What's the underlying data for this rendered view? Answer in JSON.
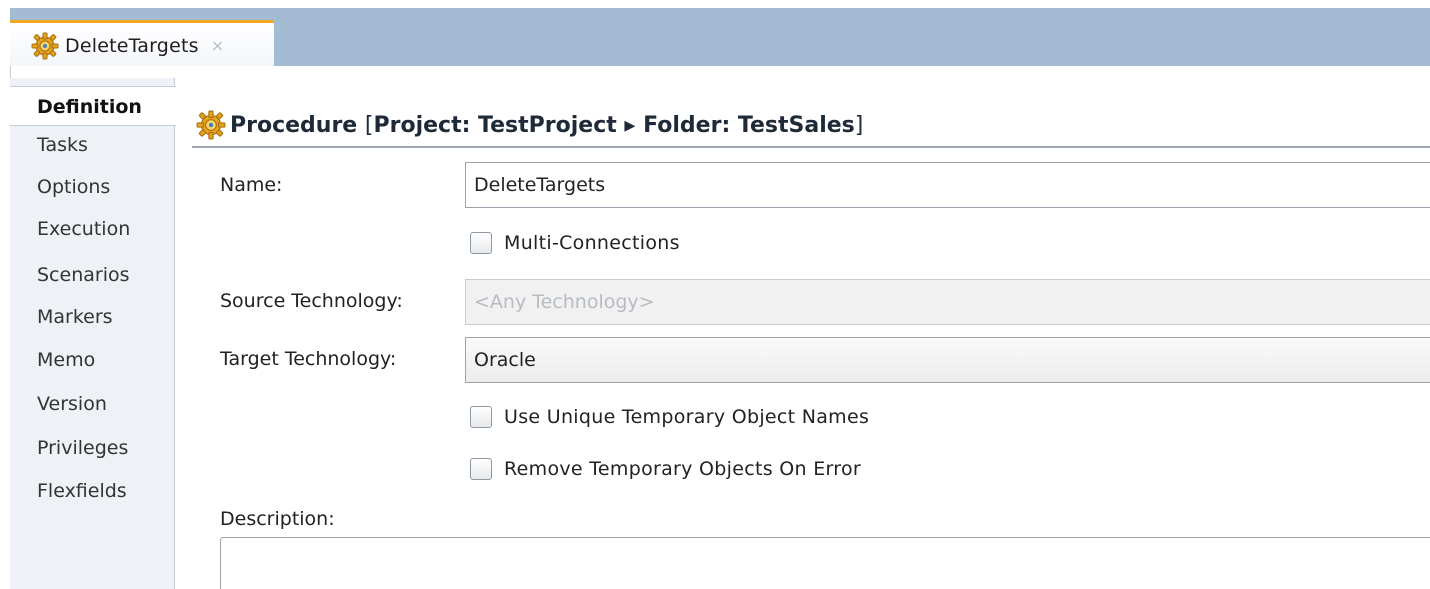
{
  "editor_tab": {
    "label": "DeleteTargets",
    "close_glyph": "×",
    "icon": "procedure-gear-icon"
  },
  "sidebar": {
    "items": [
      {
        "label": "Definition",
        "active": true
      },
      {
        "label": "Tasks",
        "active": false
      },
      {
        "label": "Options",
        "active": false
      },
      {
        "label": "Execution",
        "active": false
      },
      {
        "label": "Scenarios",
        "active": false
      },
      {
        "label": "Markers",
        "active": false
      },
      {
        "label": "Memo",
        "active": false
      },
      {
        "label": "Version",
        "active": false
      },
      {
        "label": "Privileges",
        "active": false
      },
      {
        "label": "Flexfields",
        "active": false
      }
    ]
  },
  "header": {
    "icon": "procedure-gear-icon",
    "title_prefix": "Procedure ",
    "bracket_open": "[",
    "project_part": "Project: TestProject ▸ Folder: TestSales",
    "bracket_close": "]"
  },
  "form": {
    "name_label": "Name:",
    "name_value": "DeleteTargets",
    "multi_connections_label": "Multi-Connections",
    "multi_connections_checked": false,
    "source_technology_label": "Source Technology:",
    "source_technology_value": "<Any Technology>",
    "target_technology_label": "Target Technology:",
    "target_technology_value": "Oracle",
    "unique_temp_names_label": "Use Unique Temporary Object Names",
    "unique_temp_names_checked": false,
    "remove_temp_on_error_label": "Remove Temporary Objects On Error",
    "remove_temp_on_error_checked": false,
    "description_label": "Description:",
    "description_value": ""
  },
  "colors": {
    "tabbar_bg": "#a3bbd3",
    "tab_accent": "#f5a623",
    "sidebar_bg": "#eef2f6"
  }
}
